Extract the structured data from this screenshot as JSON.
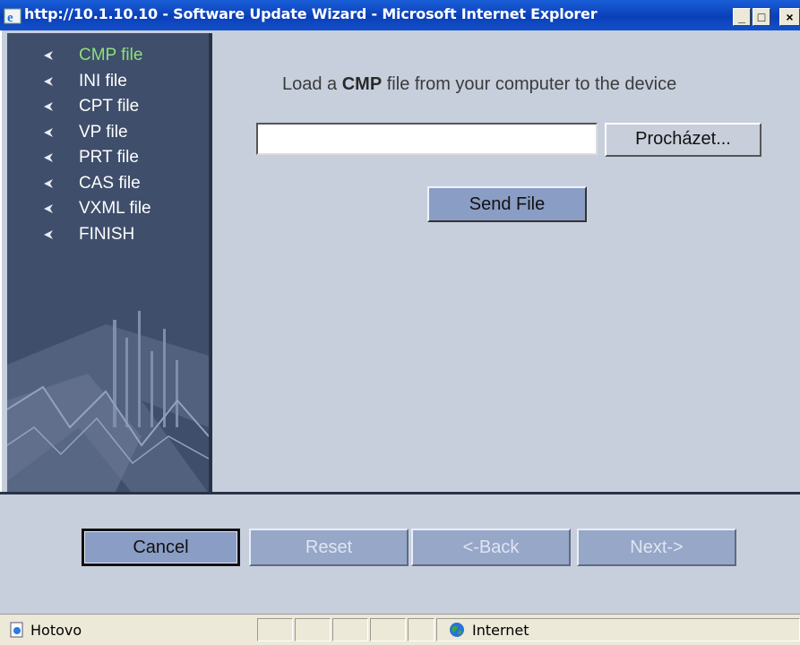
{
  "window": {
    "title": "http://10.1.10.10 - Software Update Wizard - Microsoft Internet Explorer",
    "minimize": "_",
    "maximize": "□",
    "close": "×"
  },
  "sidebar": {
    "items": [
      {
        "label": "CMP file",
        "active": true
      },
      {
        "label": "INI file"
      },
      {
        "label": "CPT file"
      },
      {
        "label": "VP file"
      },
      {
        "label": "PRT file"
      },
      {
        "label": "CAS file"
      },
      {
        "label": "VXML file"
      },
      {
        "label": "FINISH"
      }
    ]
  },
  "main": {
    "instruction_pre": "Load a ",
    "instruction_bold": "CMP",
    "instruction_post": " file from your computer to the device",
    "file_value": "",
    "browse_label": "Procházet...",
    "send_label": "Send File"
  },
  "footer": {
    "cancel": "Cancel",
    "reset": "Reset",
    "back": "<-Back",
    "next": "Next->"
  },
  "statusbar": {
    "status_text": "Hotovo",
    "zone": "Internet"
  },
  "colors": {
    "active_item": "#8de07a",
    "sidebar_bg": "#3f4e6b",
    "button_bg": "#8a9dc4"
  }
}
